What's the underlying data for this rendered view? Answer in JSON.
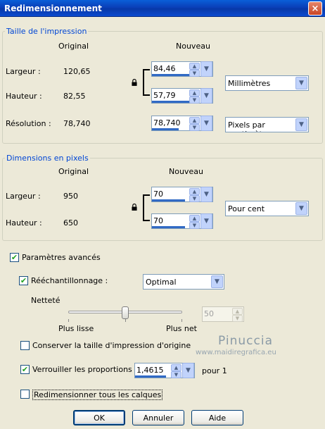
{
  "window": {
    "title": "Redimensionnement",
    "close_label": "×"
  },
  "print_size": {
    "legend": "Taille de l'impression",
    "col_original": "Original",
    "col_new": "Nouveau",
    "width_label": "Largeur :",
    "width_original": "120,65",
    "width_new": "84,46",
    "height_label": "Hauteur :",
    "height_original": "82,55",
    "height_new": "57,79",
    "unit": "Millimètres",
    "resolution_label": "Résolution :",
    "resolution_original": "78,740",
    "resolution_new": "78,740",
    "resolution_unit": "Pixels par centimètre"
  },
  "pixel_size": {
    "legend": "Dimensions en pixels",
    "col_original": "Original",
    "col_new": "Nouveau",
    "width_label": "Largeur :",
    "width_original": "950",
    "width_new": "70",
    "height_label": "Hauteur :",
    "height_original": "650",
    "height_new": "70",
    "unit": "Pour cent"
  },
  "advanced": {
    "label": "Paramètres avancés",
    "checked": true,
    "resample_label": "Rééchantillonnage :",
    "resample_checked": true,
    "resample_method": "Optimal",
    "sharpness_label": "Netteté",
    "sharpness_value": "50",
    "slider_min_label": "Plus lisse",
    "slider_max_label": "Plus net",
    "keep_print_size_label": "Conserver la taille d'impression d'origine",
    "keep_print_size_checked": false,
    "lock_ratio_label": "Verrouiller les proportions :",
    "lock_ratio_checked": true,
    "ratio_value": "1,4615",
    "ratio_suffix": "pour 1",
    "resize_all_layers_label": "Redimensionner tous les calques",
    "resize_all_layers_checked": false
  },
  "watermark": {
    "line1": "Pinuccia",
    "line2": "www.maidiregrafica.eu"
  },
  "buttons": {
    "ok": "OK",
    "cancel": "Annuler",
    "help": "Aide"
  }
}
